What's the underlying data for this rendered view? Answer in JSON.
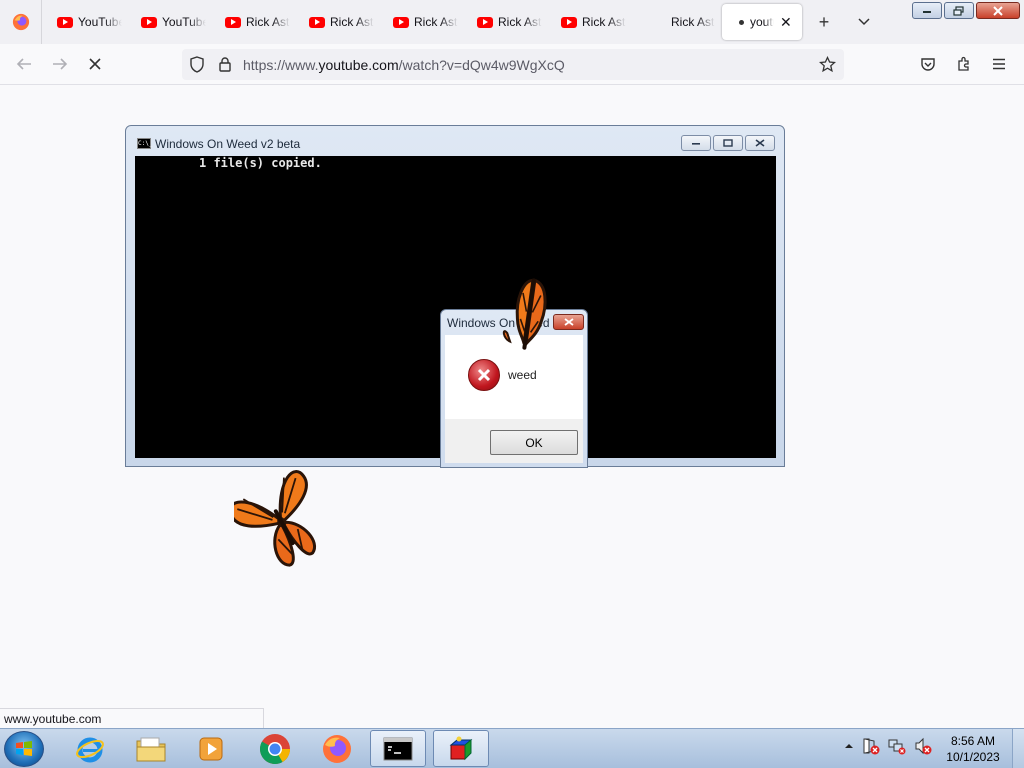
{
  "browser": {
    "tabs": [
      {
        "label": "YouTube"
      },
      {
        "label": "YouTube"
      },
      {
        "label": "Rick Astley"
      },
      {
        "label": "Rick Astley"
      },
      {
        "label": "Rick Astley"
      },
      {
        "label": "Rick Astley"
      },
      {
        "label": "Rick Astley"
      },
      {
        "label": "Rick Astley"
      },
      {
        "label": "youtube"
      }
    ],
    "url_prefix": "https://www.",
    "url_host": "youtube.com",
    "url_path": "/watch?v=dQw4w9WgXcQ",
    "status_link": "www.youtube.com"
  },
  "console_window": {
    "title": "Windows On Weed v2 beta",
    "output": "1 file(s) copied."
  },
  "message_box": {
    "title": "Windows On Weed",
    "message": "weed",
    "ok_label": "OK"
  },
  "taskbar": {
    "time": "8:56 AM",
    "date": "10/1/2023"
  },
  "icons": [
    "firefox-icon",
    "youtube-icon",
    "shield-icon",
    "lock-icon",
    "star-icon",
    "pocket-icon",
    "extensions-icon",
    "menu-icon",
    "error-icon",
    "windows-start-icon",
    "internet-explorer-icon",
    "folder-icon",
    "media-player-icon",
    "chrome-icon",
    "cmd-icon",
    "butterfly"
  ],
  "colors": {
    "youtube_red": "#ff0000",
    "console_bg": "#000000",
    "error_red": "#c0161e",
    "butterfly_orange": "#f07a1a"
  }
}
